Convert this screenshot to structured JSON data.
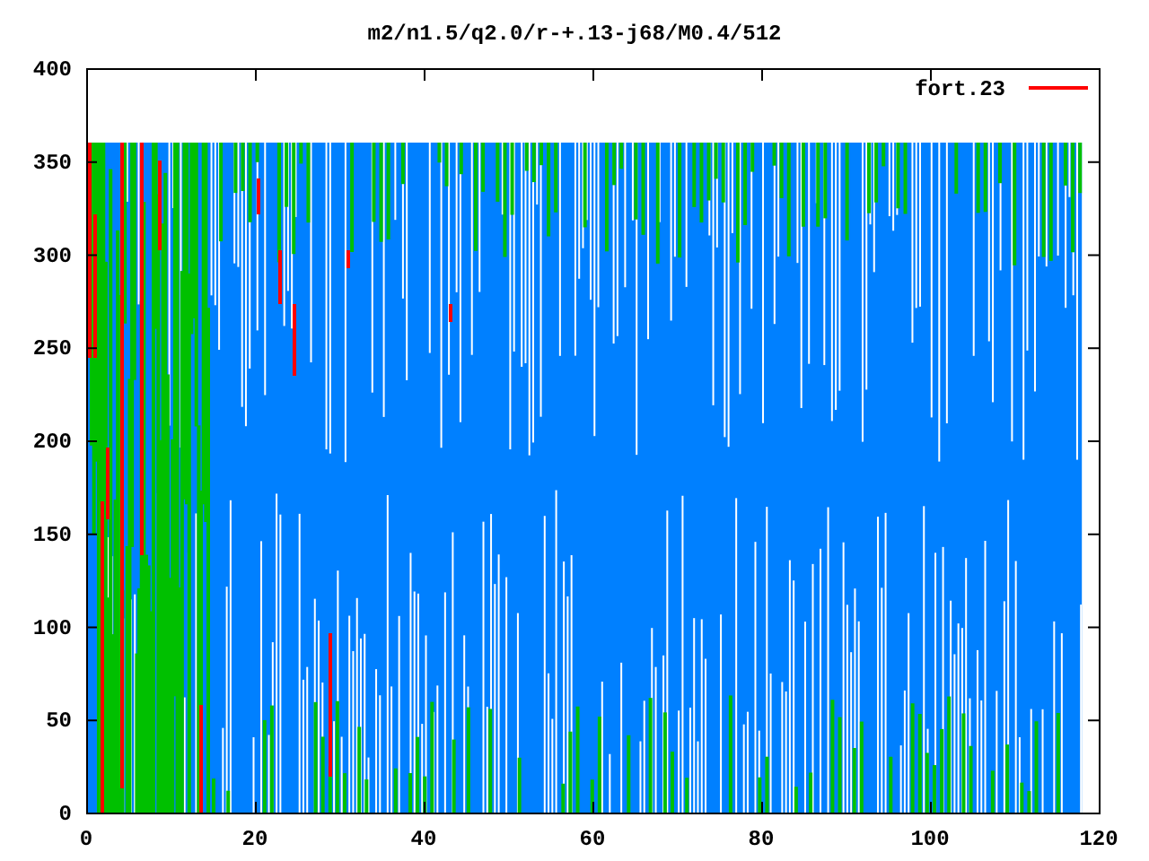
{
  "title": "m2/n1.5/q2.0/r-+.13-j68/M0.4/512",
  "legend": [
    {
      "label": "fort.23",
      "color": "#ff0000"
    }
  ],
  "x_axis": {
    "ticks": [
      "0",
      "20",
      "40",
      "60",
      "80",
      "100",
      "120"
    ]
  },
  "y_axis": {
    "ticks": [
      "400",
      "350",
      "300",
      "250",
      "200",
      "150",
      "100",
      "50",
      "0"
    ]
  }
}
